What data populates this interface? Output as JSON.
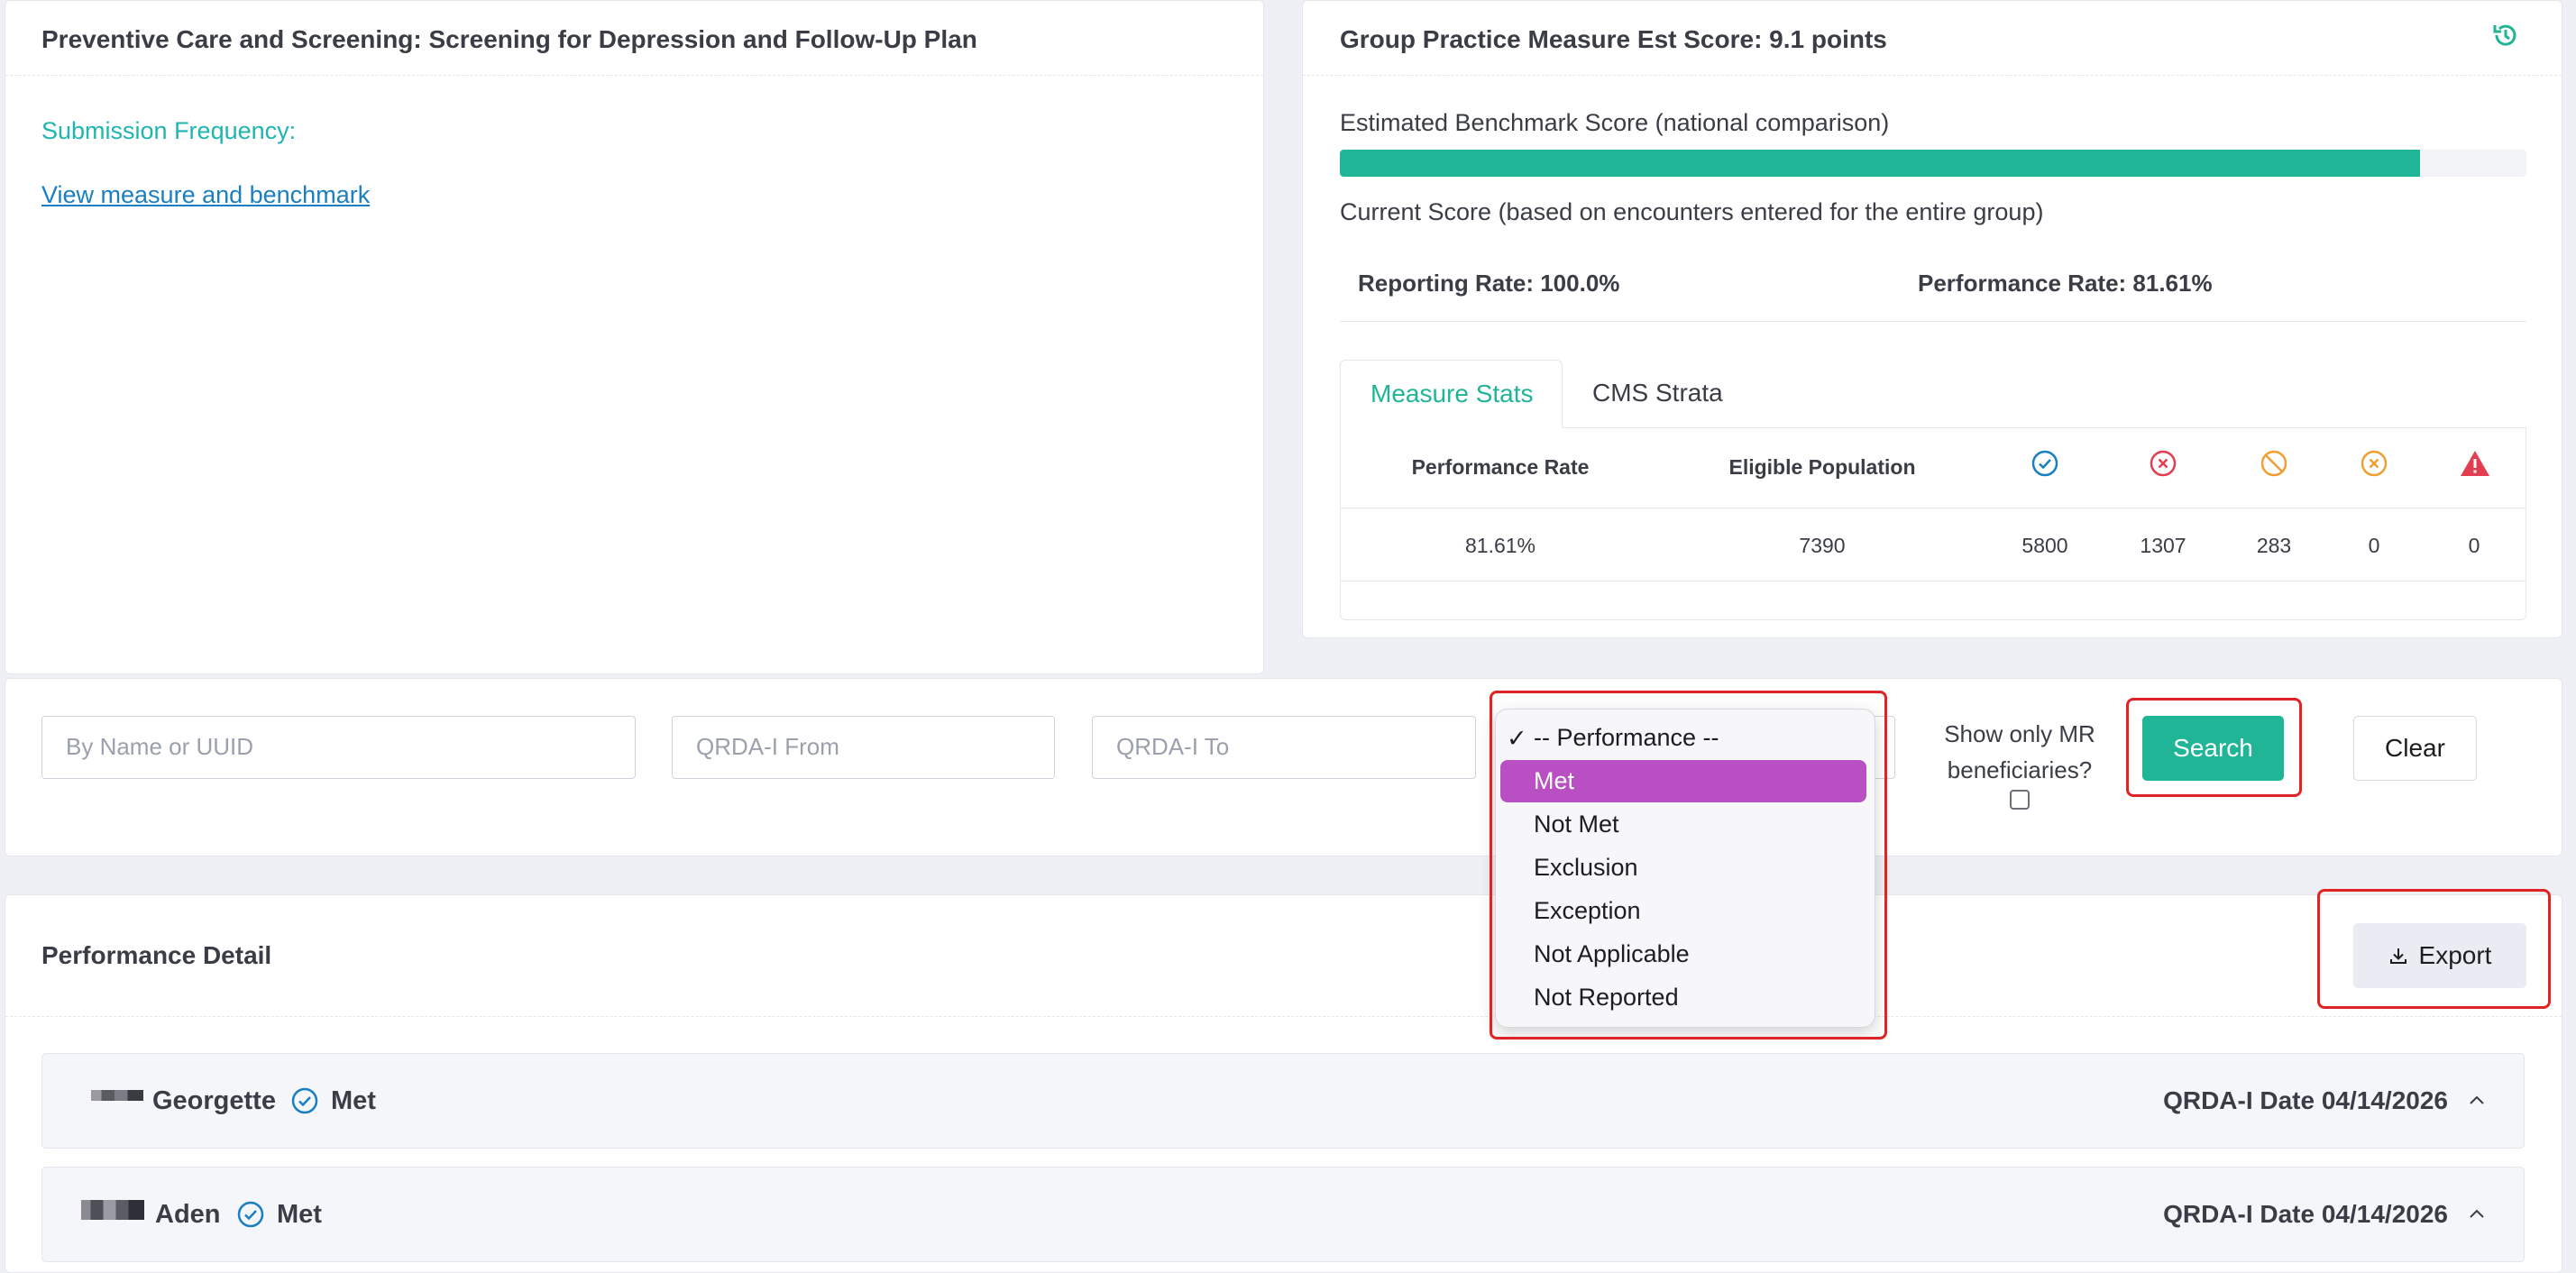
{
  "measure_card": {
    "title": "Preventive Care and Screening: Screening for Depression and Follow-Up Plan",
    "submission_label": "Submission Frequency:",
    "view_link": "View measure and benchmark"
  },
  "score_card": {
    "title": "Group Practice Measure Est Score: 9.1 points",
    "benchmark_label": "Estimated Benchmark Score (national comparison)",
    "benchmark_fill_fraction": 0.91,
    "current_label": "Current Score (based on encounters entered for the entire group)",
    "reporting_rate": "Reporting Rate: 100.0%",
    "performance_rate": "Performance Rate: 81.61%",
    "tabs": [
      {
        "label": "Measure Stats",
        "active": true
      },
      {
        "label": "CMS Strata",
        "active": false
      }
    ],
    "stats": {
      "headers": [
        "Performance Rate",
        "Eligible Population"
      ],
      "icons": [
        "met-icon",
        "not-met-icon",
        "not-applicable-icon",
        "exception-icon",
        "warning-icon"
      ],
      "values": [
        "81.61%",
        "7390",
        "5800",
        "1307",
        "283",
        "0",
        "0"
      ]
    }
  },
  "filters": {
    "name_placeholder": "By Name or UUID",
    "from_placeholder": "QRDA-I From",
    "to_placeholder": "QRDA-I To",
    "performance_dropdown": {
      "options": [
        "-- Performance --",
        "Met",
        "Not Met",
        "Exclusion",
        "Exception",
        "Not Applicable",
        "Not Reported"
      ],
      "checked": "-- Performance --",
      "highlighted": "Met"
    },
    "mr_label_line1": "Show only MR",
    "mr_label_line2": "beneficiaries?",
    "search_label": "Search",
    "clear_label": "Clear"
  },
  "detail": {
    "title": "Performance Detail",
    "export_label": "Export",
    "rows": [
      {
        "name": "Georgette",
        "status": "Met",
        "date": "QRDA-I Date 04/14/2026"
      },
      {
        "name": "Aden",
        "status": "Met",
        "date": "QRDA-I Date 04/14/2026"
      }
    ]
  },
  "colors": {
    "accent": "#1fb596",
    "link": "#1a7fc1",
    "highlight": "#b84fc2",
    "met": "#1a7fc1",
    "not_met": "#e33d52",
    "not_applicable": "#f0a033",
    "exception": "#f0a033",
    "warning": "#e33d52",
    "annotation": "#e02424"
  }
}
